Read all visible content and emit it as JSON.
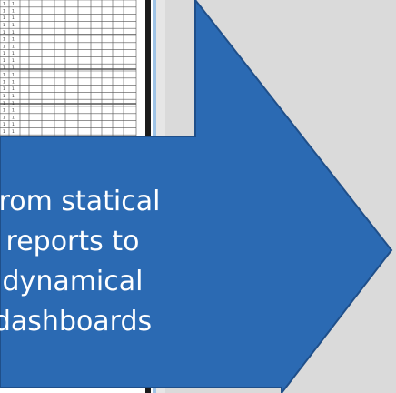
{
  "arrow": {
    "lines": [
      "From statical",
      "reports to",
      "dynamical",
      "dashboards"
    ]
  },
  "report_table": {
    "cell_value": "1"
  },
  "colors": {
    "arrow_fill": "#2b6ab3",
    "arrow_stroke": "#1f4f8a",
    "background": "#dadada",
    "text": "#ffffff"
  }
}
